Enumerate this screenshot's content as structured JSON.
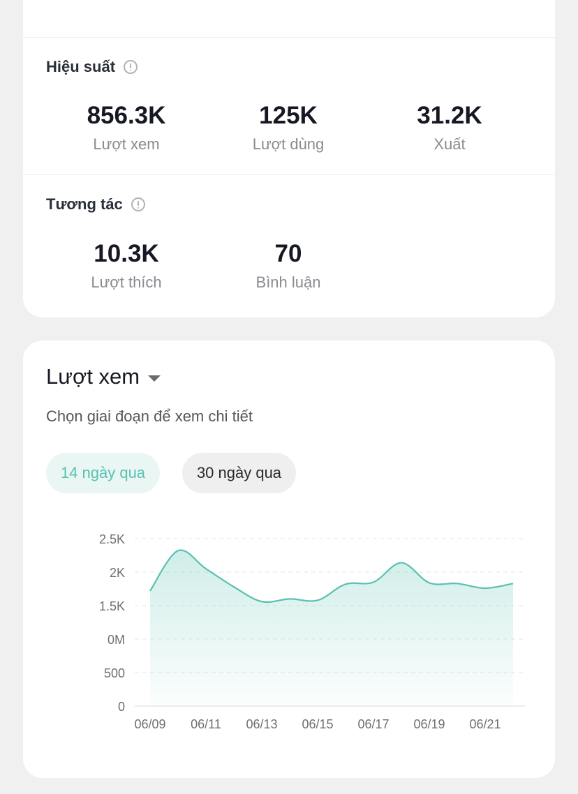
{
  "performance": {
    "title": "Hiệu suất",
    "metrics": [
      {
        "value": "856.3K",
        "label": "Lượt xem"
      },
      {
        "value": "125K",
        "label": "Lượt dùng"
      },
      {
        "value": "31.2K",
        "label": "Xuất"
      }
    ]
  },
  "engagement": {
    "title": "Tương tác",
    "metrics": [
      {
        "value": "10.3K",
        "label": "Lượt thích"
      },
      {
        "value": "70",
        "label": "Bình luận"
      }
    ]
  },
  "views": {
    "title": "Lượt xem",
    "subtitle": "Chọn giai đoạn để xem chi tiết",
    "range_options": [
      "14 ngày qua",
      "30 ngày qua"
    ],
    "selected_range": "14 ngày qua"
  },
  "colors": {
    "accent": "#58c1b0",
    "accent_bg": "#eaf6f4"
  },
  "chart_data": {
    "type": "area",
    "y_tick_labels": [
      "0",
      "500",
      "0M",
      "1.5K",
      "2K",
      "2.5K"
    ],
    "x_tick_labels": [
      "06/09",
      "06/11",
      "06/13",
      "06/15",
      "06/17",
      "06/19",
      "06/21"
    ],
    "x": [
      "06/09",
      "06/10",
      "06/11",
      "06/12",
      "06/13",
      "06/14",
      "06/15",
      "06/16",
      "06/17",
      "06/18",
      "06/19",
      "06/20",
      "06/21",
      "06/22"
    ],
    "values": [
      1720,
      2320,
      2050,
      1780,
      1560,
      1600,
      1580,
      1820,
      1850,
      2140,
      1840,
      1830,
      1760,
      1830
    ],
    "ylim": [
      0,
      2500
    ],
    "grid": true
  }
}
